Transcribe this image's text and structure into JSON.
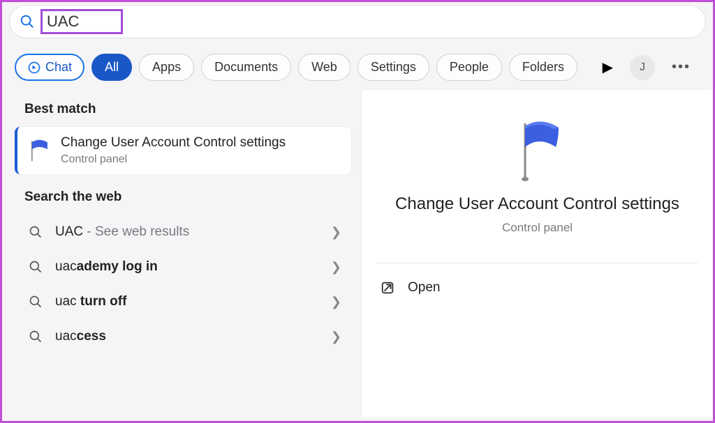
{
  "search": {
    "query": "UAC"
  },
  "filters": {
    "chat": "Chat",
    "all": "All",
    "apps": "Apps",
    "documents": "Documents",
    "web": "Web",
    "settings": "Settings",
    "people": "People",
    "folders": "Folders"
  },
  "avatar": {
    "initial": "J"
  },
  "left": {
    "best_match_heading": "Best match",
    "best_match": {
      "title": "Change User Account Control settings",
      "subtitle": "Control panel"
    },
    "search_web_heading": "Search the web",
    "web_results": [
      {
        "prefix": "UAC",
        "bold": "",
        "suffix": " - See web results"
      },
      {
        "prefix": "uac",
        "bold": "ademy log in",
        "suffix": ""
      },
      {
        "prefix": "uac ",
        "bold": "turn off",
        "suffix": ""
      },
      {
        "prefix": "uac",
        "bold": "cess",
        "suffix": ""
      }
    ]
  },
  "preview": {
    "title": "Change User Account Control settings",
    "subtitle": "Control panel",
    "open": "Open"
  }
}
